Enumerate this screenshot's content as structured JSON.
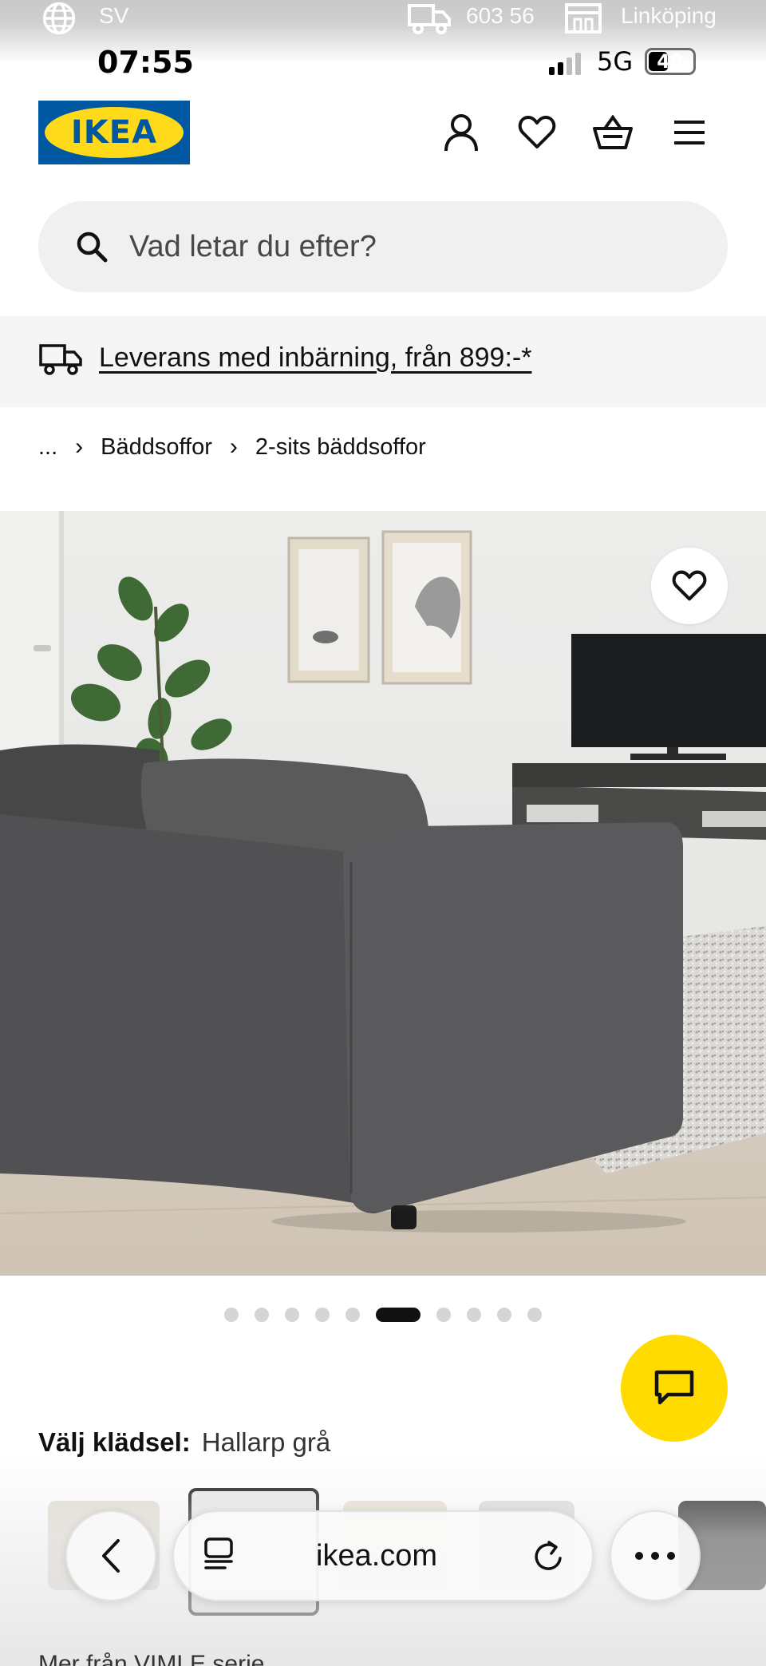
{
  "site_header": {
    "language": "SV",
    "postal_code": "603 56",
    "store": "Linköping"
  },
  "status_bar": {
    "time": "07:55",
    "network": "5G",
    "battery": "40"
  },
  "header": {
    "logo_text": "IKEA",
    "brand_colors": {
      "blue": "#0058a3",
      "yellow": "#ffda1a"
    }
  },
  "search": {
    "placeholder": "Vad letar du efter?"
  },
  "delivery": {
    "text": "Leverans med inbärning, från 899:-*"
  },
  "breadcrumb": {
    "items": [
      "...",
      "Bäddsoffor",
      "2-sits bäddsoffor"
    ]
  },
  "gallery": {
    "image_count": 10,
    "active_index": 6
  },
  "upholstery": {
    "label": "Välj klädsel:",
    "value": "Hallarp grå"
  },
  "browser": {
    "url": "ikea.com"
  },
  "more_from_series": "Mer från VIMLE serie"
}
